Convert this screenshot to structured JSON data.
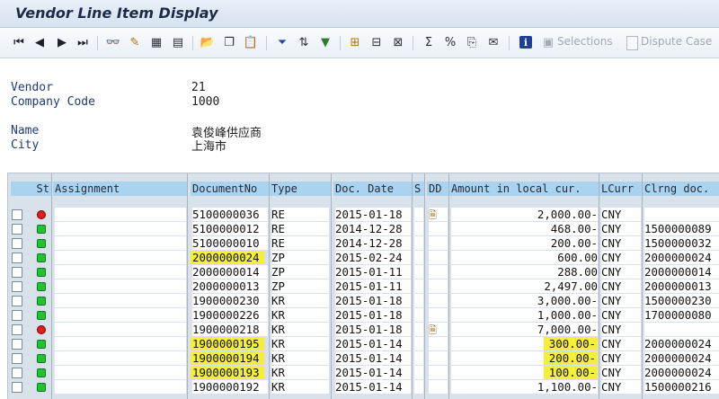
{
  "window": {
    "title": "Vendor Line Item Display"
  },
  "toolbar": {
    "selections_label": "Selections",
    "dispute_case_label": "Dispute Case"
  },
  "header": {
    "vendor_label": "Vendor",
    "vendor_value": "21",
    "company_code_label": "Company Code",
    "company_code_value": "1000",
    "name_label": "Name",
    "name_value": "袁俊峰供应商",
    "city_label": "City",
    "city_value": "上海市"
  },
  "table": {
    "columns": [
      "St",
      "Assignment",
      "DocumentNo",
      "Type",
      "Doc. Date",
      "S",
      "DD",
      "Amount in local cur.",
      "LCurr",
      "Clrng doc."
    ],
    "rows": [
      {
        "status": "red",
        "assignment": "",
        "docno": "5100000036",
        "type": "RE",
        "date": "2015-01-18",
        "s": "",
        "dd": "doc-icon",
        "amount": "2,000.00-",
        "curr": "CNY",
        "clrng": ""
      },
      {
        "status": "green",
        "assignment": "",
        "docno": "5100000012",
        "type": "RE",
        "date": "2014-12-28",
        "s": "",
        "dd": "",
        "amount": "468.00-",
        "curr": "CNY",
        "clrng": "1500000089"
      },
      {
        "status": "green",
        "assignment": "",
        "docno": "5100000010",
        "type": "RE",
        "date": "2014-12-28",
        "s": "",
        "dd": "",
        "amount": "200.00-",
        "curr": "CNY",
        "clrng": "1500000032"
      },
      {
        "status": "green",
        "assignment": "",
        "docno": "2000000024",
        "type": "ZP",
        "date": "2015-02-24",
        "s": "",
        "dd": "",
        "amount": "600.00",
        "curr": "CNY",
        "clrng": "2000000024",
        "hl_doc": true
      },
      {
        "status": "green",
        "assignment": "",
        "docno": "2000000014",
        "type": "ZP",
        "date": "2015-01-11",
        "s": "",
        "dd": "",
        "amount": "288.00",
        "curr": "CNY",
        "clrng": "2000000014"
      },
      {
        "status": "green",
        "assignment": "",
        "docno": "2000000013",
        "type": "ZP",
        "date": "2015-01-11",
        "s": "",
        "dd": "",
        "amount": "2,497.00",
        "curr": "CNY",
        "clrng": "2000000013"
      },
      {
        "status": "green",
        "assignment": "",
        "docno": "1900000230",
        "type": "KR",
        "date": "2015-01-18",
        "s": "",
        "dd": "",
        "amount": "3,000.00-",
        "curr": "CNY",
        "clrng": "1500000230"
      },
      {
        "status": "green",
        "assignment": "",
        "docno": "1900000226",
        "type": "KR",
        "date": "2015-01-18",
        "s": "",
        "dd": "",
        "amount": "1,000.00-",
        "curr": "CNY",
        "clrng": "1700000080"
      },
      {
        "status": "red",
        "assignment": "",
        "docno": "1900000218",
        "type": "KR",
        "date": "2015-01-18",
        "s": "",
        "dd": "doc-icon",
        "amount": "7,000.00-",
        "curr": "CNY",
        "clrng": ""
      },
      {
        "status": "green",
        "assignment": "",
        "docno": "1900000195",
        "type": "KR",
        "date": "2015-01-14",
        "s": "",
        "dd": "",
        "amount": "300.00-",
        "curr": "CNY",
        "clrng": "2000000024",
        "hl_doc": true,
        "hl_amt": true
      },
      {
        "status": "green",
        "assignment": "",
        "docno": "1900000194",
        "type": "KR",
        "date": "2015-01-14",
        "s": "",
        "dd": "",
        "amount": "200.00-",
        "curr": "CNY",
        "clrng": "2000000024",
        "hl_doc": true,
        "hl_amt": true
      },
      {
        "status": "green",
        "assignment": "",
        "docno": "1900000193",
        "type": "KR",
        "date": "2015-01-14",
        "s": "",
        "dd": "",
        "amount": "100.00-",
        "curr": "CNY",
        "clrng": "2000000024",
        "hl_doc": true,
        "hl_amt": true
      },
      {
        "status": "green",
        "assignment": "",
        "docno": "1900000192",
        "type": "KR",
        "date": "2015-01-14",
        "s": "",
        "dd": "",
        "amount": "1,100.00-",
        "curr": "CNY",
        "clrng": "1500000216"
      }
    ]
  },
  "colors": {
    "led_green": "#22c32e",
    "led_red": "#e31c1c",
    "highlight": "#f4ef38",
    "header_bg": "#a9d3ef"
  }
}
